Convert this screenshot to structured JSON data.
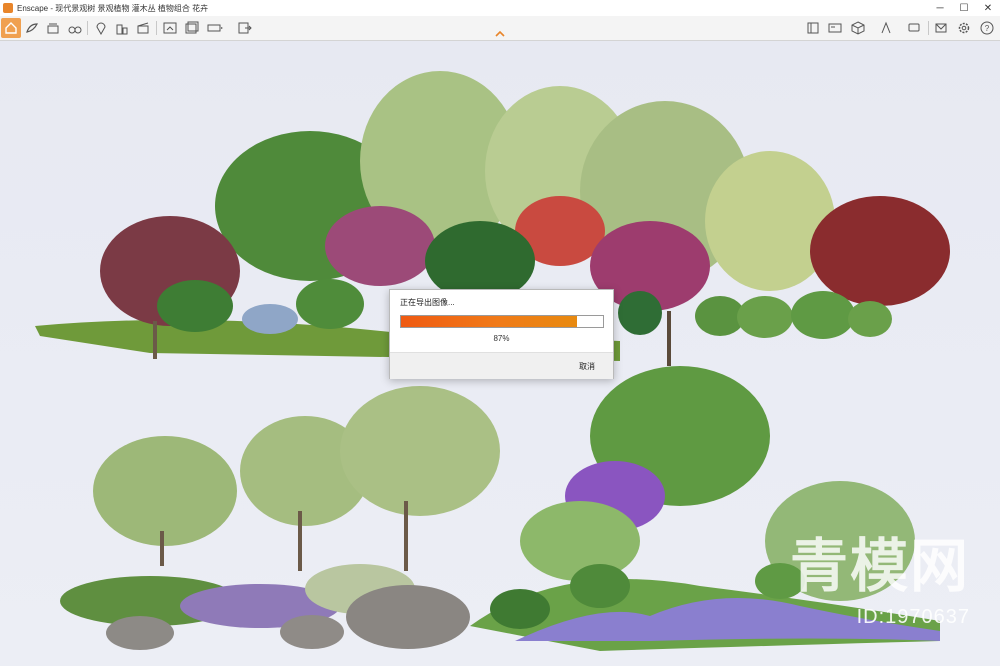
{
  "window": {
    "title": "Enscape - 现代景观树 景观植物 灌木丛 植物组合 花卉",
    "controls": [
      "─",
      "☐",
      "✕"
    ]
  },
  "toolbar": {
    "left_icons": [
      "home-icon",
      "visual-settings-icon",
      "bim-icon",
      "binoculars-icon",
      "location-icon",
      "buildings-icon",
      "clapper-icon",
      "screenshot-icon",
      "batch-export-icon",
      "panorama-icon",
      "export-icon"
    ],
    "right_icons": [
      "asset-library-icon",
      "material-editor-icon",
      "cube-icon",
      "upload-icon",
      "feedback-icon",
      "settings-icon",
      "help-icon"
    ]
  },
  "dialog": {
    "title": "正在导出图像...",
    "progress": 0.87,
    "progress_label": "87%",
    "cancel_label": "取消",
    "accent": "#ef6414"
  },
  "watermark": {
    "brand": "青模网",
    "id_text": "ID:1970637"
  }
}
